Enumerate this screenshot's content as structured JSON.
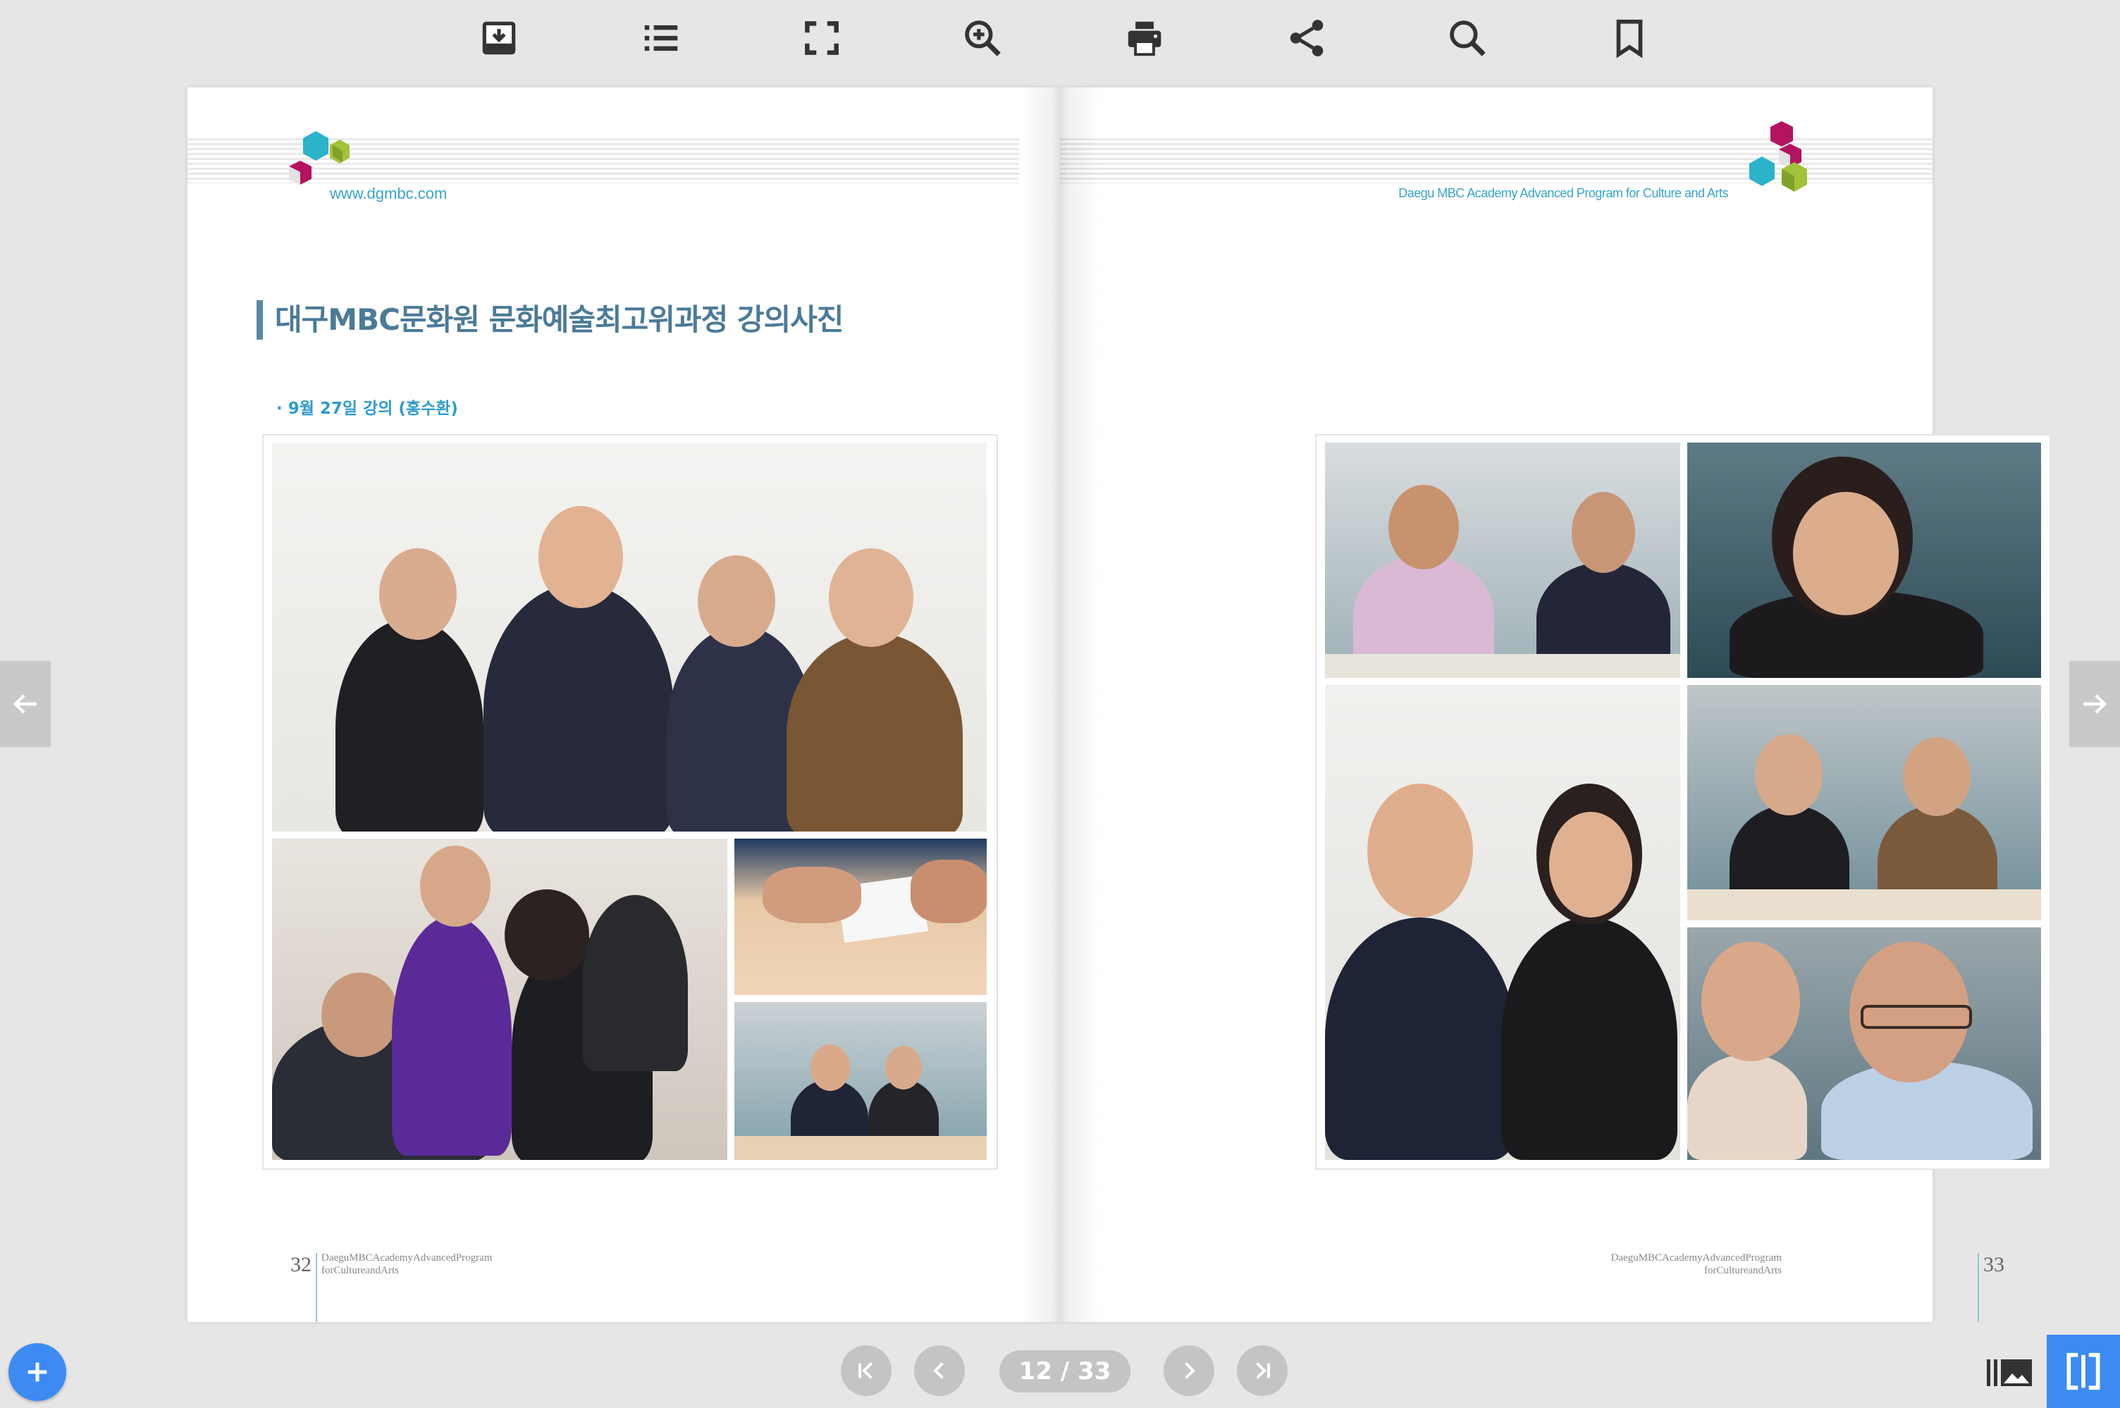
{
  "toolbar": {
    "items": [
      {
        "name": "download-icon"
      },
      {
        "name": "table-of-contents-icon"
      },
      {
        "name": "fullscreen-icon"
      },
      {
        "name": "zoom-in-icon"
      },
      {
        "name": "print-icon"
      },
      {
        "name": "share-icon"
      },
      {
        "name": "search-icon"
      },
      {
        "name": "bookmark-icon"
      }
    ]
  },
  "left_page": {
    "url": "www.dgmbc.com",
    "title": "대구MBC문화원 문화예술최고위과정 강의사진",
    "subtitle": "· 9월 27일 강의 (홍수환)",
    "page_number": "32",
    "footer_line1": "DaeguMBCAcademyAdvancedProgram",
    "footer_line2": "forCultureandArts"
  },
  "right_page": {
    "tagline": "Daegu MBC Academy Advanced Program for Culture and Arts",
    "page_number": "33",
    "footer_line1": "DaeguMBCAcademyAdvancedProgram",
    "footer_line2": "forCultureandArts"
  },
  "navigation": {
    "page_indicator": "12 / 33"
  },
  "colors": {
    "accent_blue": "#3d8bf2",
    "logo_teal": "#2bb3c9",
    "logo_magenta": "#b3135f",
    "logo_green": "#a2c23a",
    "title_color": "#4b7b98"
  }
}
